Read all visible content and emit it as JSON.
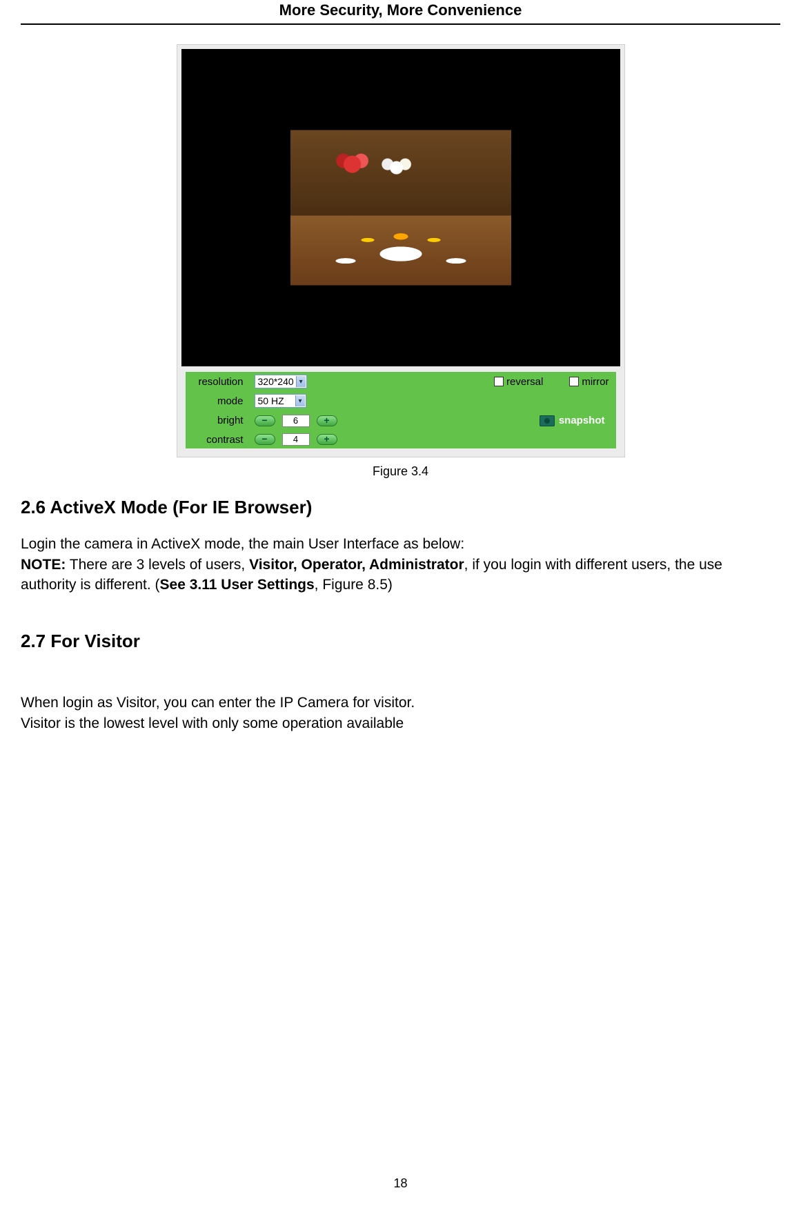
{
  "header": {
    "title": "More Security, More Convenience"
  },
  "figure": {
    "caption": "Figure 3.4",
    "controls": {
      "resolution_label": "resolution",
      "resolution_value": "320*240",
      "mode_label": "mode",
      "mode_value": "50 HZ",
      "bright_label": "bright",
      "bright_value": "6",
      "contrast_label": "contrast",
      "contrast_value": "4",
      "reversal_label": "reversal",
      "mirror_label": "mirror",
      "snapshot_label": "snapshot",
      "minus": "−",
      "plus": "+"
    }
  },
  "sections": {
    "s26": {
      "heading": "2.6 ActiveX Mode (For IE Browser)",
      "p1": "Login the camera in ActiveX mode, the main User Interface as below:",
      "note_label": "NOTE:",
      "note_a": " There are 3 levels of users, ",
      "note_bold": "Visitor, Operator, Administrator",
      "note_b": ", if you login with different users, the use authority is different. (",
      "note_see": "See 3.11 User Settings",
      "note_c": ", Figure 8.5)"
    },
    "s27": {
      "heading": "2.7 For Visitor",
      "p1": "When login as Visitor, you can enter the IP Camera for visitor.",
      "p2": "Visitor is the lowest level with only some operation available"
    }
  },
  "page_number": "18"
}
